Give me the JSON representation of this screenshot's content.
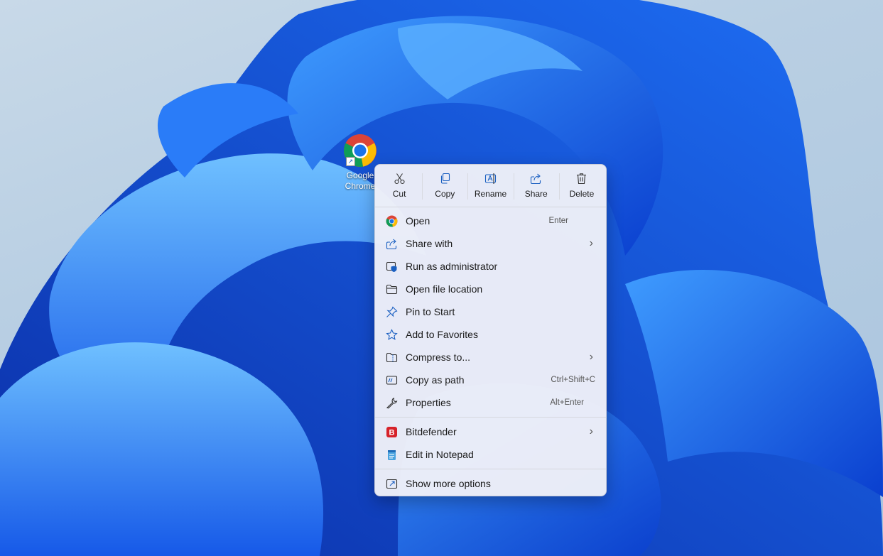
{
  "desktop": {
    "icon_label": "Google\nChrome"
  },
  "quick_actions": [
    {
      "label": "Cut",
      "icon": "cut-icon"
    },
    {
      "label": "Copy",
      "icon": "copy-icon"
    },
    {
      "label": "Rename",
      "icon": "rename-icon"
    },
    {
      "label": "Share",
      "icon": "share-icon"
    },
    {
      "label": "Delete",
      "icon": "delete-icon"
    }
  ],
  "menu_items": [
    {
      "label": "Open",
      "shortcut": "Enter",
      "icon": "chrome-icon"
    },
    {
      "label": "Share with",
      "submenu": true,
      "icon": "share-with-icon"
    },
    {
      "label": "Run as administrator",
      "icon": "shield-icon"
    },
    {
      "label": "Open file location",
      "icon": "folder-icon"
    },
    {
      "label": "Pin to Start",
      "icon": "pin-icon"
    },
    {
      "label": "Add to Favorites",
      "icon": "star-icon"
    },
    {
      "label": "Compress to...",
      "submenu": true,
      "icon": "zip-icon"
    },
    {
      "label": "Copy as path",
      "shortcut": "Ctrl+Shift+C",
      "icon": "path-icon"
    },
    {
      "label": "Properties",
      "shortcut": "Alt+Enter",
      "icon": "wrench-icon"
    }
  ],
  "extra_items": [
    {
      "label": "Bitdefender",
      "submenu": true,
      "icon": "bitdefender-icon"
    },
    {
      "label": "Edit in Notepad",
      "icon": "notepad-icon"
    }
  ],
  "more_options": {
    "label": "Show more options",
    "icon": "more-options-icon"
  },
  "colors": {
    "accent": "#0067c0",
    "bitdefender": "#d6222a",
    "menu_bg": "#eef0f8"
  }
}
